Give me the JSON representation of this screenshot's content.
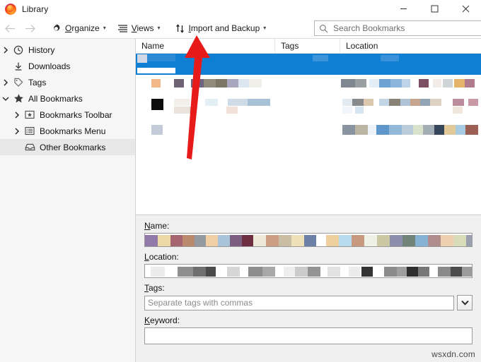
{
  "window": {
    "title": "Library",
    "app_icon": "firefox-logo-icon",
    "controls": {
      "minimize": "minimize-icon",
      "maximize": "maximize-icon",
      "close": "close-icon"
    }
  },
  "toolbar": {
    "back": "back-arrow-icon",
    "forward": "forward-arrow-icon",
    "items": [
      {
        "label": "Organize",
        "accesskey": "O",
        "icon": "gear-icon",
        "caret": "˅"
      },
      {
        "label": "Views",
        "accesskey": "V",
        "icon": "list-view-icon",
        "caret": "˅"
      },
      {
        "label": "Import and Backup",
        "accesskey": "I",
        "icon": "import-export-arrows-icon",
        "caret": "˅"
      }
    ],
    "organize_pre": "",
    "organize_key": "O",
    "organize_post": "rganize",
    "views_pre": "",
    "views_key": "V",
    "views_post": "iews",
    "import_key": "I",
    "import_post": "mport and Backup"
  },
  "search": {
    "icon": "search-icon",
    "placeholder": "Search Bookmarks",
    "value": ""
  },
  "sidebar": {
    "items": [
      {
        "label": "History",
        "icon": "clock-icon",
        "twisty": "collapsed",
        "indent": 0,
        "selected": false
      },
      {
        "label": "Downloads",
        "icon": "download-icon",
        "twisty": "none",
        "indent": 0,
        "selected": false
      },
      {
        "label": "Tags",
        "icon": "tag-icon",
        "twisty": "collapsed",
        "indent": 0,
        "selected": false
      },
      {
        "label": "All Bookmarks",
        "icon": "star-icon",
        "twisty": "expanded",
        "indent": 0,
        "selected": false
      },
      {
        "label": "Bookmarks Toolbar",
        "icon": "bookmarks-toolbar-icon",
        "twisty": "collapsed",
        "indent": 1,
        "selected": false
      },
      {
        "label": "Bookmarks Menu",
        "icon": "bookmarks-menu-icon",
        "twisty": "collapsed",
        "indent": 1,
        "selected": false
      },
      {
        "label": "Other Bookmarks",
        "icon": "inbox-icon",
        "twisty": "none",
        "indent": 1,
        "selected": true
      }
    ]
  },
  "list": {
    "columns": [
      {
        "key": "name",
        "label": "Name"
      },
      {
        "key": "tags",
        "label": "Tags"
      },
      {
        "key": "location",
        "label": "Location"
      }
    ],
    "rows": [
      {
        "name": "",
        "tags": "",
        "location": "",
        "selected": true,
        "redacted": true
      },
      {
        "name": "",
        "tags": "",
        "location": "",
        "selected": false,
        "redacted": true
      },
      {
        "name": "",
        "tags": "",
        "location": "",
        "selected": false,
        "redacted": true
      },
      {
        "name": "",
        "tags": "",
        "location": "",
        "selected": false,
        "redacted": true
      }
    ]
  },
  "detail": {
    "name": {
      "label": "Name:",
      "accesskey": "N",
      "label_rest": "ame:",
      "value": "",
      "redacted": true
    },
    "location": {
      "label": "Location:",
      "accesskey": "L",
      "label_rest": "ocation:",
      "value": "",
      "redacted": true
    },
    "tags": {
      "label": "Tags:",
      "accesskey": "T",
      "label_rest": "ags:",
      "value": "",
      "placeholder": "Separate tags with commas",
      "dropdown_icon": "chevron-down-icon"
    },
    "keyword": {
      "label": "Keyword:",
      "accesskey": "K",
      "label_rest": "eyword:",
      "value": "",
      "placeholder": ""
    }
  },
  "annotation": {
    "type": "arrow",
    "color": "#e81b1b",
    "points_to": "Import and Backup"
  },
  "watermark": {
    "text": "wsxdn.com"
  },
  "colors": {
    "selection_blue": "#0f7fd4",
    "sidebar_bg": "#f6f6f6",
    "detail_bg": "#f0f0f0",
    "annotation_red": "#e81b1b"
  }
}
